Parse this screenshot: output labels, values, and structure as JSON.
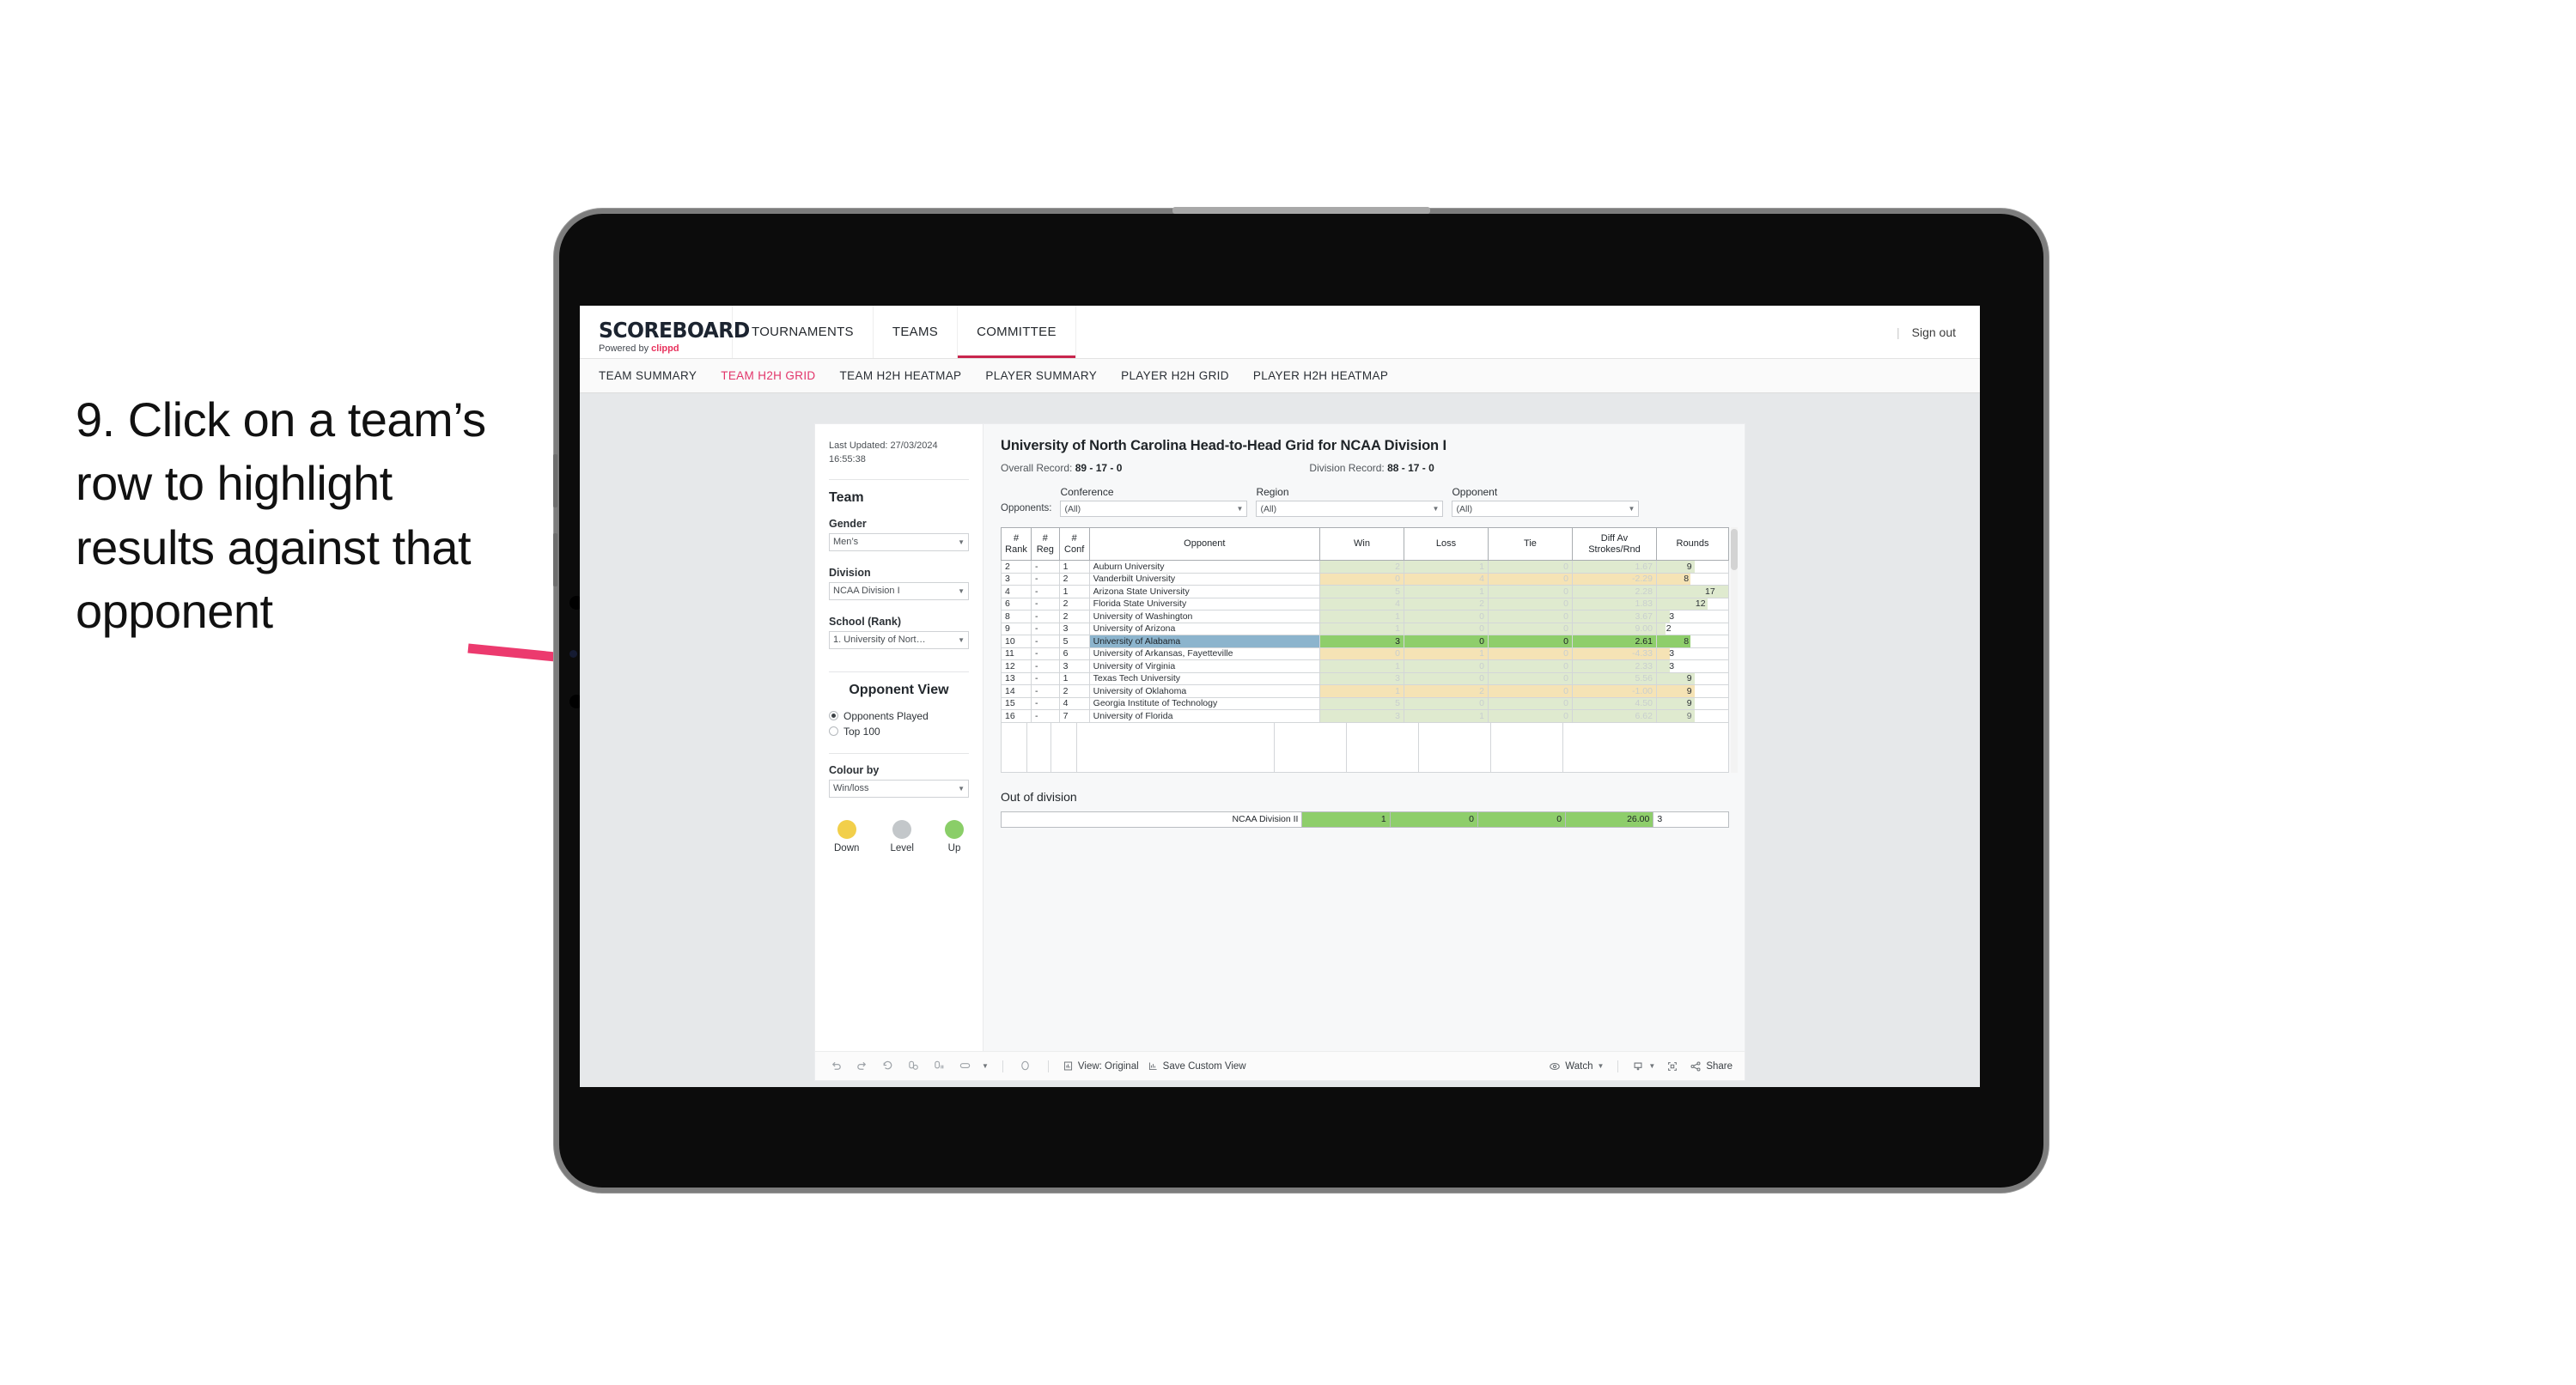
{
  "annotation": {
    "text": "9. Click on a team’s row to highlight results against that opponent",
    "arrow_color": "#ec3a6e"
  },
  "topnav": {
    "logo_word": "SCOREBOARD",
    "logo_sub_prefix": "Powered by ",
    "logo_sub_brand": "clippd",
    "items": [
      {
        "label": "TOURNAMENTS",
        "active": false
      },
      {
        "label": "TEAMS",
        "active": false
      },
      {
        "label": "COMMITTEE",
        "active": true
      }
    ],
    "divider": "|",
    "sign_out": "Sign out"
  },
  "subnav": {
    "items": [
      {
        "label": "TEAM SUMMARY",
        "active": false
      },
      {
        "label": "TEAM H2H GRID",
        "active": true
      },
      {
        "label": "TEAM H2H HEATMAP",
        "active": false
      },
      {
        "label": "PLAYER SUMMARY",
        "active": false
      },
      {
        "label": "PLAYER H2H GRID",
        "active": false
      },
      {
        "label": "PLAYER H2H HEATMAP",
        "active": false
      }
    ]
  },
  "sidebar": {
    "last_updated": "Last Updated: 27/03/2024 16:55:38",
    "team_heading": "Team",
    "gender_label": "Gender",
    "gender_value": "Men’s",
    "division_label": "Division",
    "division_value": "NCAA Division I",
    "school_label": "School (Rank)",
    "school_value": "1. University of Nort…",
    "opponent_view_heading": "Opponent View",
    "opponent_view_options": [
      {
        "label": "Opponents Played",
        "selected": true
      },
      {
        "label": "Top 100",
        "selected": false
      }
    ],
    "colour_by_label": "Colour by",
    "colour_by_value": "Win/loss",
    "legend": [
      {
        "label": "Down",
        "color": "#f2cf4a"
      },
      {
        "label": "Level",
        "color": "#c3c7ca"
      },
      {
        "label": "Up",
        "color": "#8ace68"
      }
    ]
  },
  "main": {
    "title": "University of North Carolina Head-to-Head Grid for NCAA Division I",
    "overall_record_label": "Overall Record: ",
    "overall_record_value": "89 - 17 - 0",
    "division_record_label": "Division Record: ",
    "division_record_value": "88 - 17 - 0",
    "opponents_label": "Opponents:",
    "filters": [
      {
        "name": "Conference",
        "value": "(All)"
      },
      {
        "name": "Region",
        "value": "(All)"
      },
      {
        "name": "Opponent",
        "value": "(All)"
      }
    ]
  },
  "chart_data": {
    "type": "table",
    "title": "University of North Carolina Head-to-Head Grid for NCAA Division I",
    "columns": [
      "# Rank",
      "# Reg",
      "# Conf",
      "Opponent",
      "Win",
      "Loss",
      "Tie",
      "Diff Av Strokes/Rnd",
      "Rounds"
    ],
    "rows": [
      {
        "rank": "2",
        "reg": "-",
        "conf": "1",
        "opponent": "Auburn University",
        "win": "2",
        "loss": "1",
        "tie": "0",
        "diff": "1.67",
        "rounds": "9",
        "state": "up",
        "selected": false
      },
      {
        "rank": "3",
        "reg": "-",
        "conf": "2",
        "opponent": "Vanderbilt University",
        "win": "0",
        "loss": "4",
        "tie": "0",
        "diff": "-2.29",
        "rounds": "8",
        "state": "down",
        "selected": false
      },
      {
        "rank": "4",
        "reg": "-",
        "conf": "1",
        "opponent": "Arizona State University",
        "win": "5",
        "loss": "1",
        "tie": "0",
        "diff": "2.28",
        "rounds": "17",
        "state": "up",
        "selected": false
      },
      {
        "rank": "6",
        "reg": "-",
        "conf": "2",
        "opponent": "Florida State University",
        "win": "4",
        "loss": "2",
        "tie": "0",
        "diff": "1.83",
        "rounds": "12",
        "state": "up",
        "selected": false
      },
      {
        "rank": "8",
        "reg": "-",
        "conf": "2",
        "opponent": "University of Washington",
        "win": "1",
        "loss": "0",
        "tie": "0",
        "diff": "3.67",
        "rounds": "3",
        "state": "up",
        "selected": false
      },
      {
        "rank": "9",
        "reg": "-",
        "conf": "3",
        "opponent": "University of Arizona",
        "win": "1",
        "loss": "0",
        "tie": "0",
        "diff": "9.00",
        "rounds": "2",
        "state": "up",
        "selected": false
      },
      {
        "rank": "10",
        "reg": "-",
        "conf": "5",
        "opponent": "University of Alabama",
        "win": "3",
        "loss": "0",
        "tie": "0",
        "diff": "2.61",
        "rounds": "8",
        "state": "up",
        "selected": true
      },
      {
        "rank": "11",
        "reg": "-",
        "conf": "6",
        "opponent": "University of Arkansas, Fayetteville",
        "win": "0",
        "loss": "1",
        "tie": "0",
        "diff": "-4.33",
        "rounds": "3",
        "state": "down",
        "selected": false
      },
      {
        "rank": "12",
        "reg": "-",
        "conf": "3",
        "opponent": "University of Virginia",
        "win": "1",
        "loss": "0",
        "tie": "0",
        "diff": "2.33",
        "rounds": "3",
        "state": "up",
        "selected": false
      },
      {
        "rank": "13",
        "reg": "-",
        "conf": "1",
        "opponent": "Texas Tech University",
        "win": "3",
        "loss": "0",
        "tie": "0",
        "diff": "5.56",
        "rounds": "9",
        "state": "up",
        "selected": false
      },
      {
        "rank": "14",
        "reg": "-",
        "conf": "2",
        "opponent": "University of Oklahoma",
        "win": "1",
        "loss": "2",
        "tie": "0",
        "diff": "-1.00",
        "rounds": "9",
        "state": "down",
        "selected": false
      },
      {
        "rank": "15",
        "reg": "-",
        "conf": "4",
        "opponent": "Georgia Institute of Technology",
        "win": "5",
        "loss": "0",
        "tie": "0",
        "diff": "4.50",
        "rounds": "9",
        "state": "up",
        "selected": false
      },
      {
        "rank": "16",
        "reg": "-",
        "conf": "7",
        "opponent": "University of Florida",
        "win": "3",
        "loss": "1",
        "tie": "0",
        "diff": "6.62",
        "rounds": "9",
        "state": "up",
        "selected": false
      }
    ],
    "out_of_division": {
      "heading": "Out of division",
      "label": "NCAA Division II",
      "win": "1",
      "loss": "0",
      "tie": "0",
      "diff": "26.00",
      "rounds": "3"
    },
    "colors": {
      "up": "#8ece6b",
      "down": "#f5e3b5",
      "up_faded": "#dfeacf",
      "selected_row": "#8cb4cd"
    }
  },
  "toolbar": {
    "view_label": "View: Original",
    "save_label": "Save Custom View",
    "watch_label": "Watch",
    "share_label": "Share"
  }
}
